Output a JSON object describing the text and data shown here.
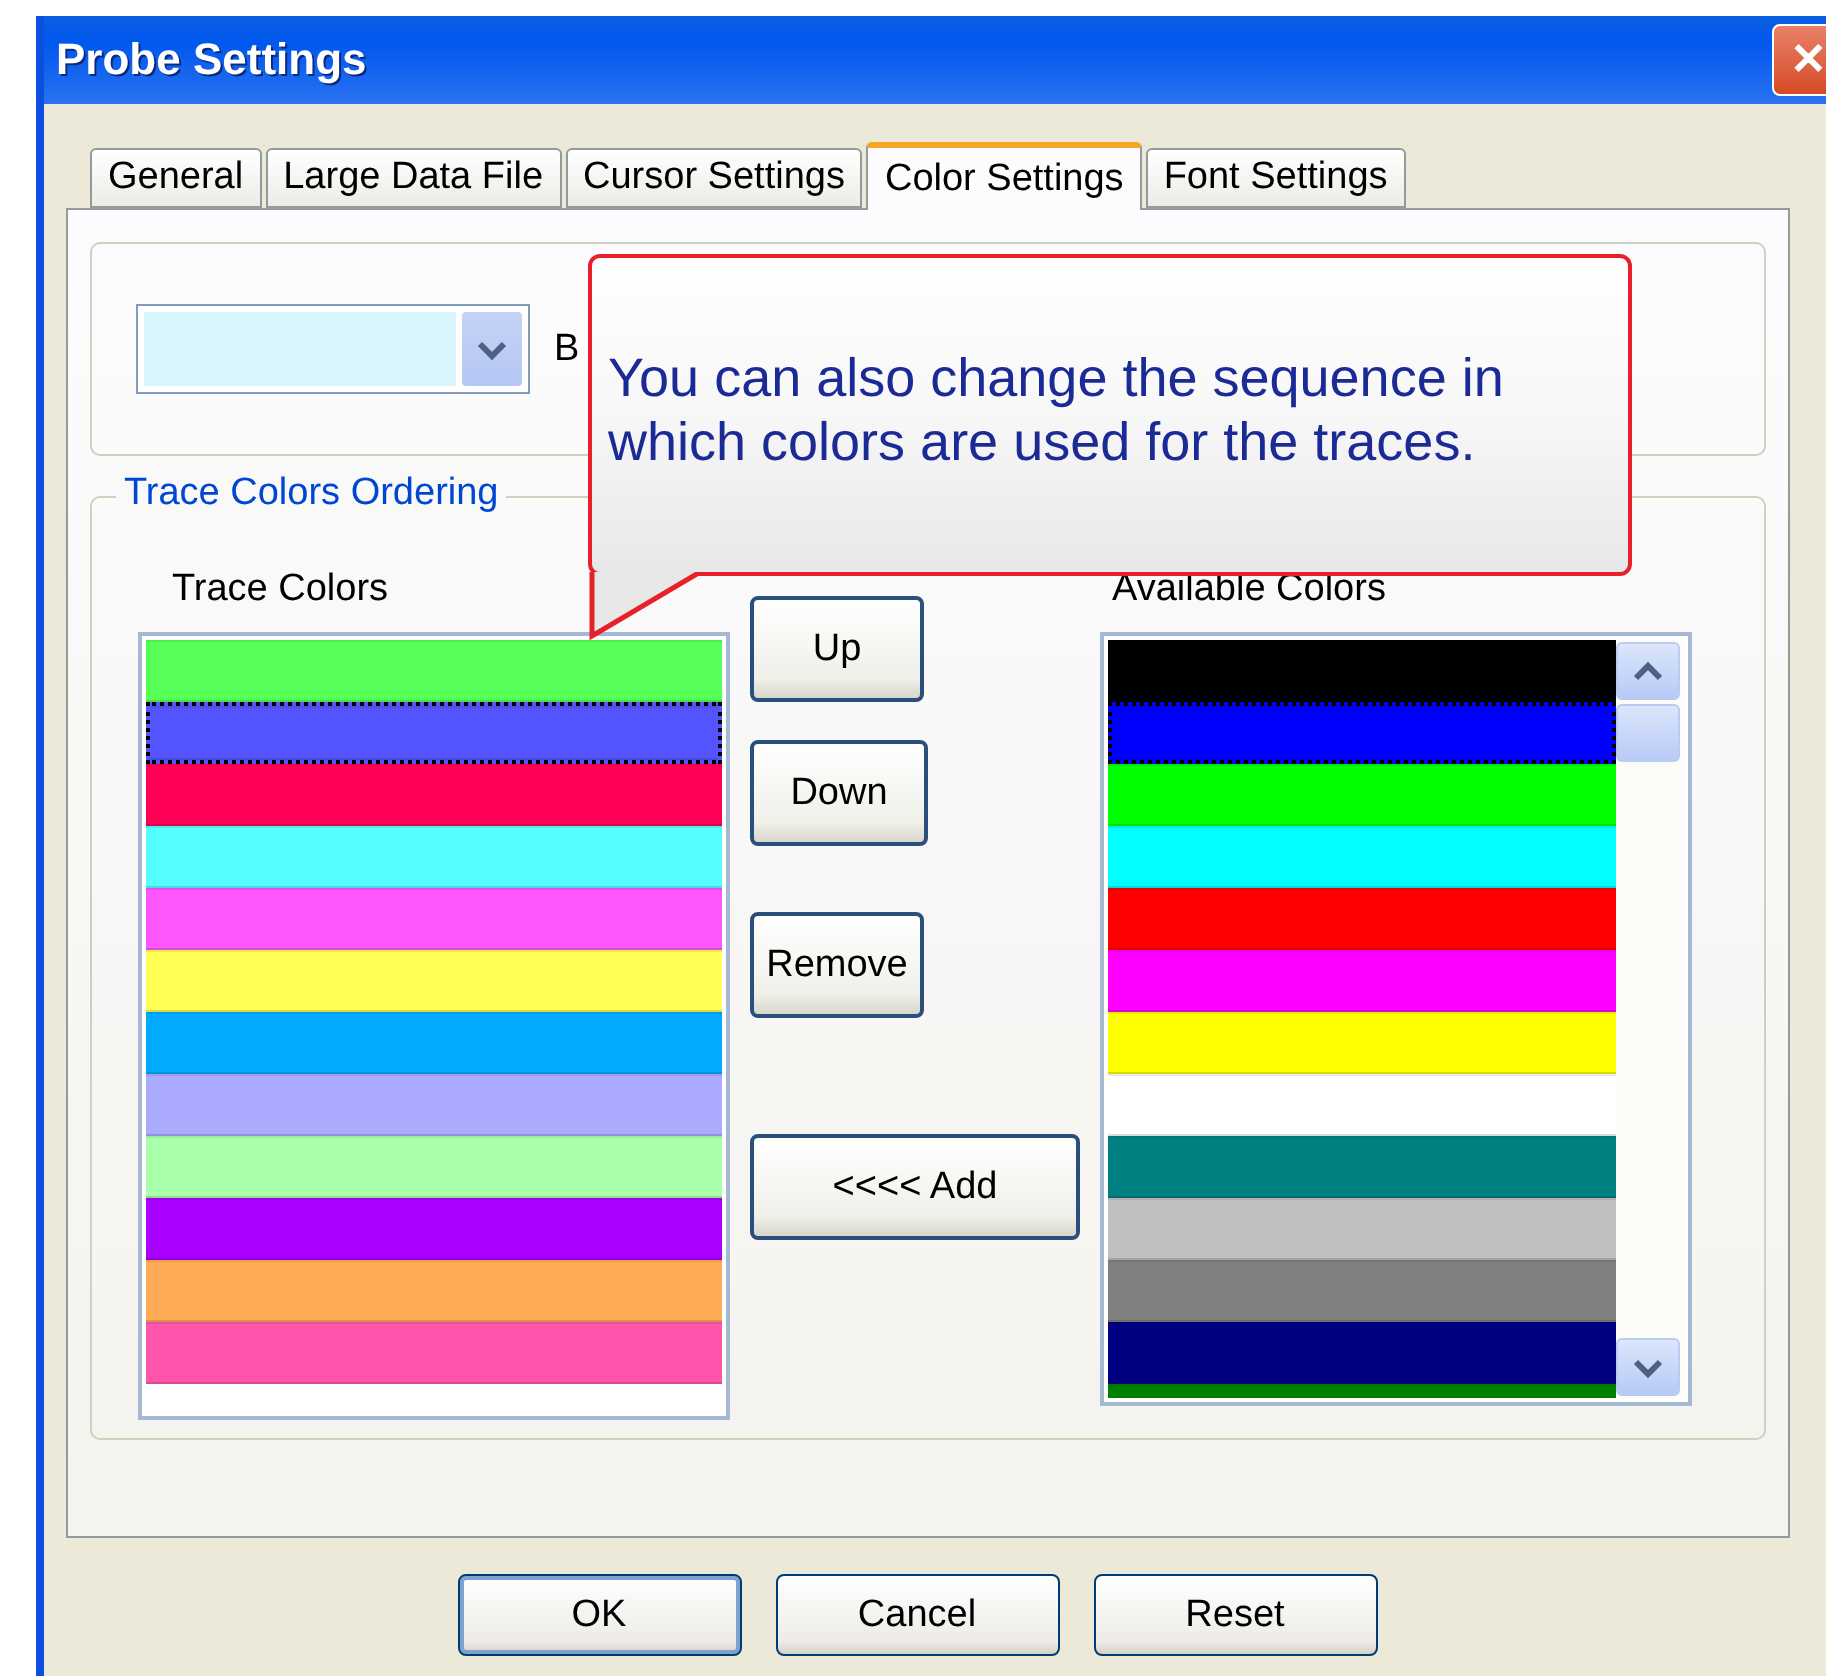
{
  "window": {
    "title": "Probe Settings",
    "close": "✕"
  },
  "tabs": [
    {
      "label": "General",
      "selected": false
    },
    {
      "label": "Large Data File",
      "selected": false
    },
    {
      "label": "Cursor Settings",
      "selected": false
    },
    {
      "label": "Color Settings",
      "selected": true
    },
    {
      "label": "Font Settings",
      "selected": false
    }
  ],
  "background_combo": {
    "color": "#d8f6fc",
    "label": "B"
  },
  "callout": {
    "text": "You can also change the sequence in which colors are used for the traces."
  },
  "group": {
    "title": "Trace Colors  Ordering"
  },
  "trace_colors": {
    "label": "Trace Colors",
    "items": [
      {
        "color": "#55ff55",
        "selected": false
      },
      {
        "color": "#5555ff",
        "selected": true
      },
      {
        "color": "#ff0055",
        "selected": false
      },
      {
        "color": "#55ffff",
        "selected": false
      },
      {
        "color": "#ff55ff",
        "selected": false
      },
      {
        "color": "#ffff55",
        "selected": false
      },
      {
        "color": "#00aaff",
        "selected": false
      },
      {
        "color": "#aaaaff",
        "selected": false
      },
      {
        "color": "#aaffaa",
        "selected": false
      },
      {
        "color": "#aa00ff",
        "selected": false
      },
      {
        "color": "#ffaa55",
        "selected": false
      },
      {
        "color": "#ff55aa",
        "selected": false
      }
    ]
  },
  "middle_buttons": [
    "Up",
    "Down",
    "Remove",
    "<<<< Add"
  ],
  "available_colors": {
    "label": "Available Colors",
    "items": [
      {
        "color": "#000000",
        "selected": false
      },
      {
        "color": "#0000ff",
        "selected": true
      },
      {
        "color": "#00ff00",
        "selected": false
      },
      {
        "color": "#00ffff",
        "selected": false
      },
      {
        "color": "#ff0000",
        "selected": false
      },
      {
        "color": "#ff00ff",
        "selected": false
      },
      {
        "color": "#ffff00",
        "selected": false
      },
      {
        "color": "#ffffff",
        "selected": false
      },
      {
        "color": "#008080",
        "selected": false
      },
      {
        "color": "#c0c0c0",
        "selected": false
      },
      {
        "color": "#808080",
        "selected": false
      },
      {
        "color": "#000080",
        "selected": false
      },
      {
        "color": "#008000",
        "selected": false
      }
    ]
  },
  "buttons": [
    {
      "label": "OK",
      "default": true
    },
    {
      "label": "Cancel",
      "default": false
    },
    {
      "label": "Reset",
      "default": false
    }
  ]
}
